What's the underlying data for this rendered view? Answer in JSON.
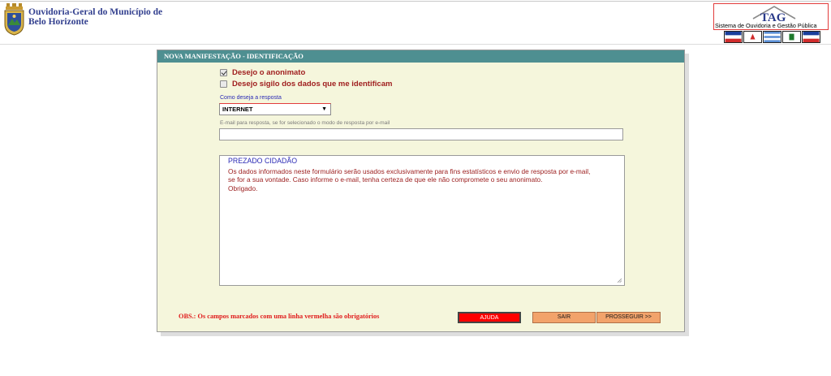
{
  "header": {
    "org_line1": "Ouvidoria-Geral do Município de",
    "org_line2": "Belo Horizonte",
    "tag_logo_text": "TAG",
    "tag_caption": "Sistema de Ouvidoria e Gestão Pública"
  },
  "flags": [
    {
      "name": "flag-1",
      "colors": [
        "#1a3e9c",
        "#ffffff",
        "#d12b2b"
      ]
    },
    {
      "name": "flag-2",
      "colors": [
        "#ffffff",
        "#d12b2b"
      ]
    },
    {
      "name": "flag-3",
      "colors": [
        "#5b8fd6",
        "#ffffff",
        "#5b8fd6"
      ]
    },
    {
      "name": "flag-4",
      "colors": [
        "#ffffff",
        "#1f7a2c"
      ]
    },
    {
      "name": "flag-5",
      "colors": [
        "#1a3e9c",
        "#ffffff",
        "#d12b2b"
      ]
    }
  ],
  "panel": {
    "title": "NOVA MANIFESTAÇÃO - IDENTIFICAÇÃO",
    "anonymous_label": "Desejo o anonimato",
    "anonymous_checked": true,
    "privacy_label": "Desejo sigilo dos dados que me identificam",
    "privacy_checked": false,
    "response_label": "Como deseja a resposta",
    "response_value": "INTERNET",
    "email_label": "E-mail para resposta, se for selecionado o modo de resposta por e-mail",
    "email_value": "",
    "info_title": "PREZADO CIDADÃO",
    "info_text": "Os dados informados neste formulário serão usados exclusivamente para fins estatísticos e envio de resposta por e-mail,\nse for a sua vontade. Caso informe o e-mail, tenha certeza de que ele não compromete o seu anonimato.\nObrigado.",
    "obs": "OBS.: Os campos marcados com uma linha vermelha são obrigatórios",
    "help_button": "AJUDA",
    "exit_button": "SAIR",
    "next_button": "PROSSEGUIR >>"
  },
  "colors": {
    "panel_header": "#4e8f91",
    "panel_bg": "#f5f6dc",
    "required_line": "#e23c3c",
    "button_orange": "#f2a36b"
  }
}
